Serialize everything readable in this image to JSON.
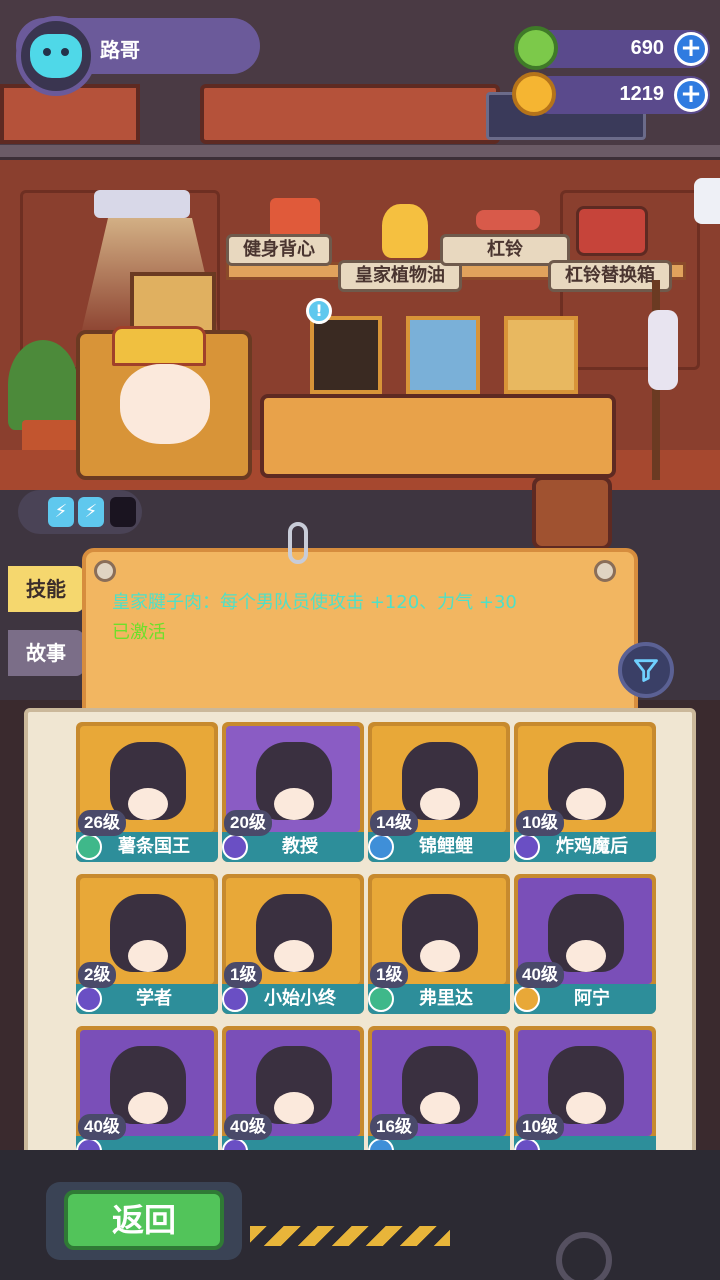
{
  "player": {
    "name": "路哥",
    "avatar_icon": "cat-face-icon"
  },
  "currencies": [
    {
      "name": "green-gem",
      "icon": "green-coin-icon",
      "value": "690",
      "color": "#7cc94a"
    },
    {
      "name": "gold-coin",
      "icon": "gold-planet-coin-icon",
      "value": "1219",
      "color": "#f5b532"
    }
  ],
  "shelf": {
    "labels": [
      "健身背心",
      "皇家植物油",
      "杠铃",
      "杠铃替换箱"
    ]
  },
  "energy": {
    "filled": 2,
    "total": 3
  },
  "tabs": [
    {
      "label": "技能",
      "active": true
    },
    {
      "label": "故事",
      "active": false
    }
  ],
  "skill": {
    "description": "皇家腱子肉：每个男队员使攻击 +120、力气 +30",
    "status": "已激活"
  },
  "characters": [
    {
      "level": "26级",
      "name": "薯条国王",
      "rank_color": "#3fb88a",
      "bg": "#e8a838"
    },
    {
      "level": "20级",
      "name": "教授",
      "rank_color": "#6a4fc4",
      "bg": "#8a5cc4"
    },
    {
      "level": "14级",
      "name": "锦鲤鲤",
      "rank_color": "#3f8fd8",
      "bg": "#e8a838"
    },
    {
      "level": "10级",
      "name": "炸鸡魔后",
      "rank_color": "#6a4fc4",
      "bg": "#e8a838"
    },
    {
      "level": "2级",
      "name": "学者",
      "rank_color": "#6a4fc4",
      "bg": "#e8a838"
    },
    {
      "level": "1级",
      "name": "小始小终",
      "rank_color": "#6a4fc4",
      "bg": "#e8a838"
    },
    {
      "level": "1级",
      "name": "弗里达",
      "rank_color": "#3fb88a",
      "bg": "#e8a838"
    },
    {
      "level": "40级",
      "name": "阿宁",
      "rank_color": "#e8a838",
      "bg": "#7a4fb8"
    },
    {
      "level": "40级",
      "name": "",
      "rank_color": "#6a4fc4",
      "bg": "#7a4fb8"
    },
    {
      "level": "40级",
      "name": "",
      "rank_color": "#6a4fc4",
      "bg": "#7a4fb8"
    },
    {
      "level": "16级",
      "name": "",
      "rank_color": "#3f8fd8",
      "bg": "#7a4fb8"
    },
    {
      "level": "10级",
      "name": "",
      "rank_color": "#6a4fc4",
      "bg": "#7a4fb8"
    }
  ],
  "back_button": {
    "label": "返回"
  },
  "icons": {
    "filter": "filter-funnel-icon",
    "wrench": "wrench-icon",
    "bolt": "lightning-bolt-icon"
  }
}
